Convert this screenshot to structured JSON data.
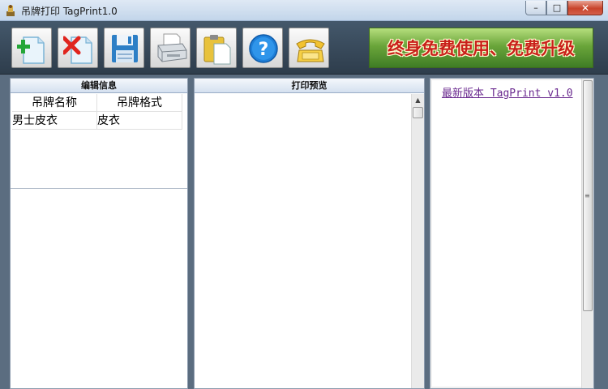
{
  "window": {
    "title": "吊牌打印 TagPrint1.0"
  },
  "caption_buttons": {
    "minimize": "–",
    "maximize": "□",
    "close": "✕"
  },
  "toolbar": {
    "buttons": [
      {
        "name": "add",
        "icon": "add-document-icon"
      },
      {
        "name": "delete",
        "icon": "delete-document-icon"
      },
      {
        "name": "save",
        "icon": "floppy-disk-icon"
      },
      {
        "name": "print",
        "icon": "printer-icon"
      },
      {
        "name": "paste",
        "icon": "clipboard-icon"
      },
      {
        "name": "help",
        "icon": "help-icon"
      },
      {
        "name": "contact",
        "icon": "telephone-icon"
      }
    ],
    "banner_text": "终身免费使用、免费升级"
  },
  "panels": {
    "edit_info": {
      "header": "编辑信息",
      "columns": [
        "吊牌名称",
        "吊牌格式"
      ],
      "rows": [
        [
          "男士皮衣",
          "皮衣"
        ]
      ]
    },
    "print_preview": {
      "header": "打印预览"
    },
    "info": {
      "link": "最新版本 TagPrint v1.0"
    }
  },
  "colors": {
    "toolbar_bg": "#3a4b5c",
    "banner_green": "#6aa53a",
    "banner_text": "#c9201a",
    "link": "#6a2a8f"
  }
}
